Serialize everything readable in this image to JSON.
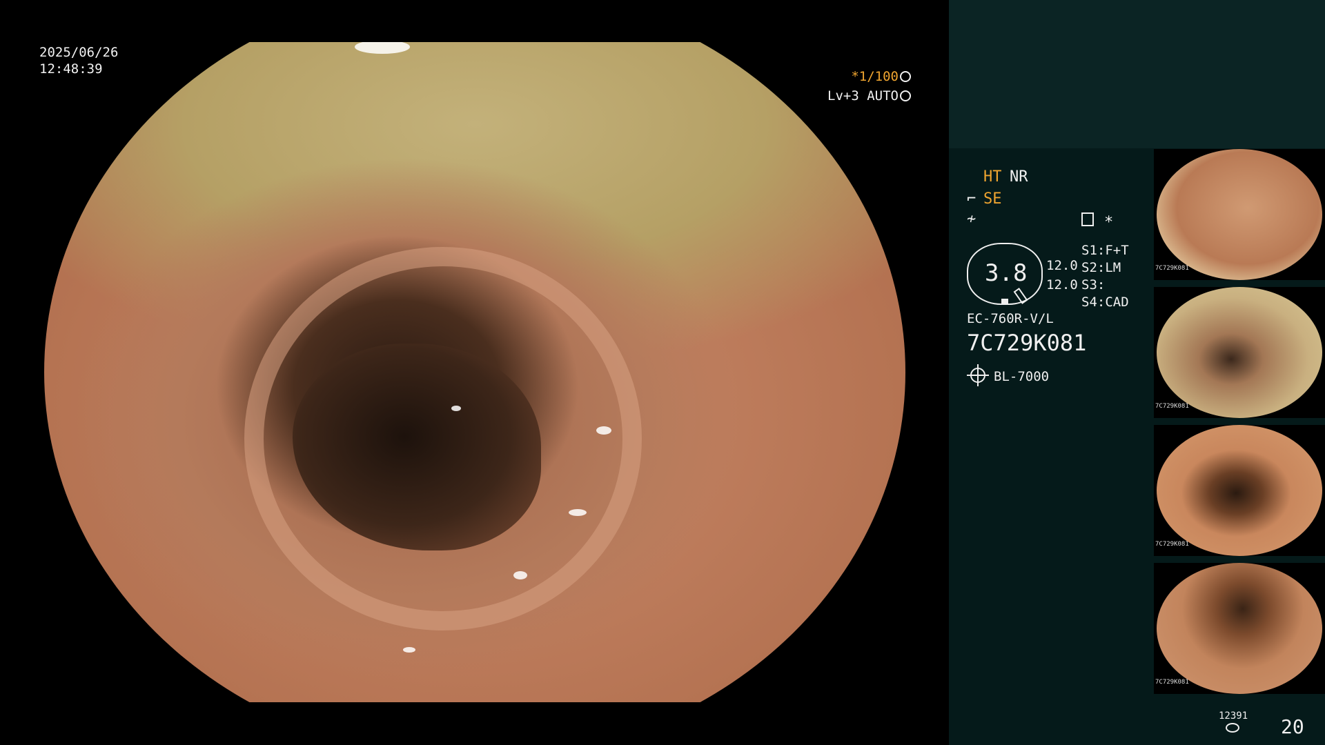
{
  "overlay": {
    "date": "2025/06/26",
    "time": "12:48:39",
    "shutter": "*1/100",
    "shutter_icon": "shutter-icon",
    "level": "Lv+3 AUTO",
    "auto_icon": "iris-icon"
  },
  "panel": {
    "ht": "HT",
    "nr": "NR",
    "se": "SE",
    "se_icon": "enhancement-icon",
    "f_icon": "filter-icon",
    "rec_icon": "record-icon",
    "star": "*",
    "gauge_value": "3.8",
    "value1": "12.0",
    "value2": "12.0",
    "s1": "S1:F+T",
    "s2": "S2:LM",
    "s3": "S3:",
    "s4": "S4:CAD",
    "model": "EC-760R-V/L",
    "serial": "7C729K081",
    "light_icon": "light-source-icon",
    "light_source": "BL-7000",
    "thumb_label": "7C729K081",
    "count_small": "12391",
    "count_icon": "storage-icon",
    "count_big": "20"
  },
  "colors": {
    "accent": "#f0a530",
    "panel_bg": "#051a1a",
    "panel_top_bg": "#0b2424",
    "text": "#f0f0f0"
  }
}
